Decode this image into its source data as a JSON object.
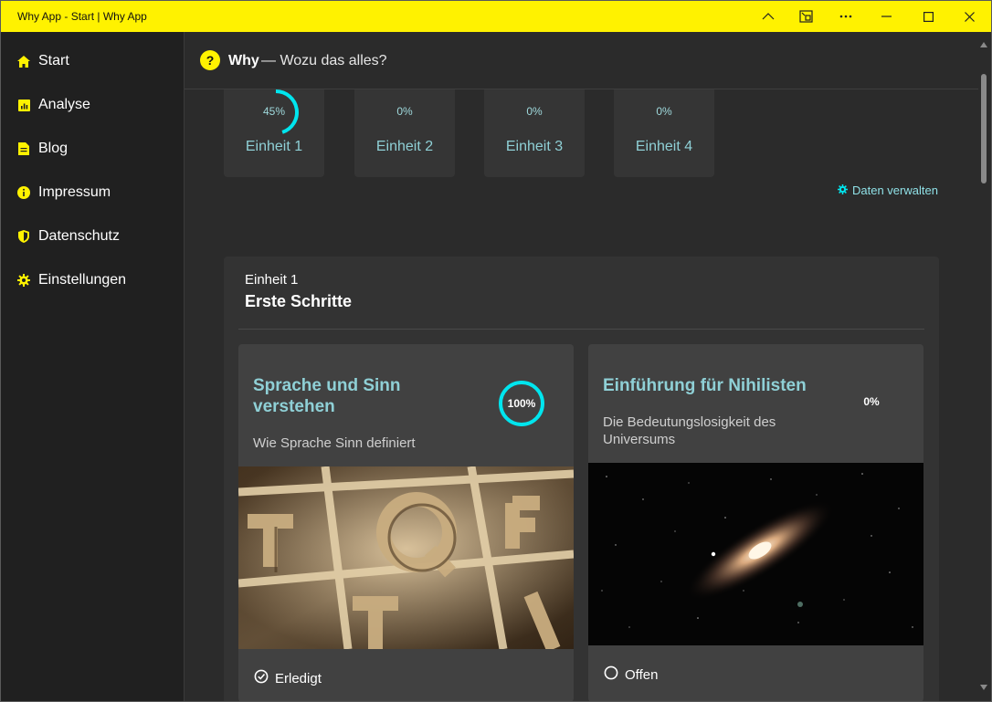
{
  "window": {
    "title": "Why App - Start | Why App",
    "controls": [
      "chevron-up-icon",
      "compact-overlay-icon",
      "more-icon",
      "minimize-icon",
      "maximize-icon",
      "close-icon"
    ]
  },
  "colors": {
    "accent": "#fff200",
    "teal": "#00e5ee",
    "tealText": "#8fd0d6",
    "background": "#2b2b2b",
    "sidebar": "#202020"
  },
  "sidebar": {
    "items": [
      {
        "label": "Start",
        "icon": "home-icon"
      },
      {
        "label": "Analyse",
        "icon": "chart-icon"
      },
      {
        "label": "Blog",
        "icon": "document-icon"
      },
      {
        "label": "Impressum",
        "icon": "info-icon"
      },
      {
        "label": "Datenschutz",
        "icon": "shield-icon"
      },
      {
        "label": "Einstellungen",
        "icon": "gear-icon"
      }
    ]
  },
  "header": {
    "icon_glyph": "?",
    "brand": "Why",
    "tagline": "— Wozu das alles?"
  },
  "units": [
    {
      "label": "Einheit 1",
      "progress_text": "45%",
      "progress": 0.45
    },
    {
      "label": "Einheit 2",
      "progress_text": "0%",
      "progress": 0
    },
    {
      "label": "Einheit 3",
      "progress_text": "0%",
      "progress": 0
    },
    {
      "label": "Einheit 4",
      "progress_text": "0%",
      "progress": 0
    }
  ],
  "manage_link": "Daten verwalten",
  "section": {
    "unit_label": "Einheit 1",
    "title": "Erste Schritte",
    "lessons": [
      {
        "title": "Sprache und Sinn verstehen",
        "description": "Wie Sprache Sinn definiert",
        "progress_text": "100%",
        "progress": 1,
        "status": "Erledigt",
        "status_icon": "check-circle-icon",
        "image": "wooden-letters-image"
      },
      {
        "title": "Einführung für Nihilisten",
        "description": "Die Bedeutungslosigkeit des Universums",
        "progress_text": "0%",
        "progress": 0,
        "status": "Offen",
        "status_icon": "circle-icon",
        "image": "galaxy-image"
      }
    ]
  }
}
